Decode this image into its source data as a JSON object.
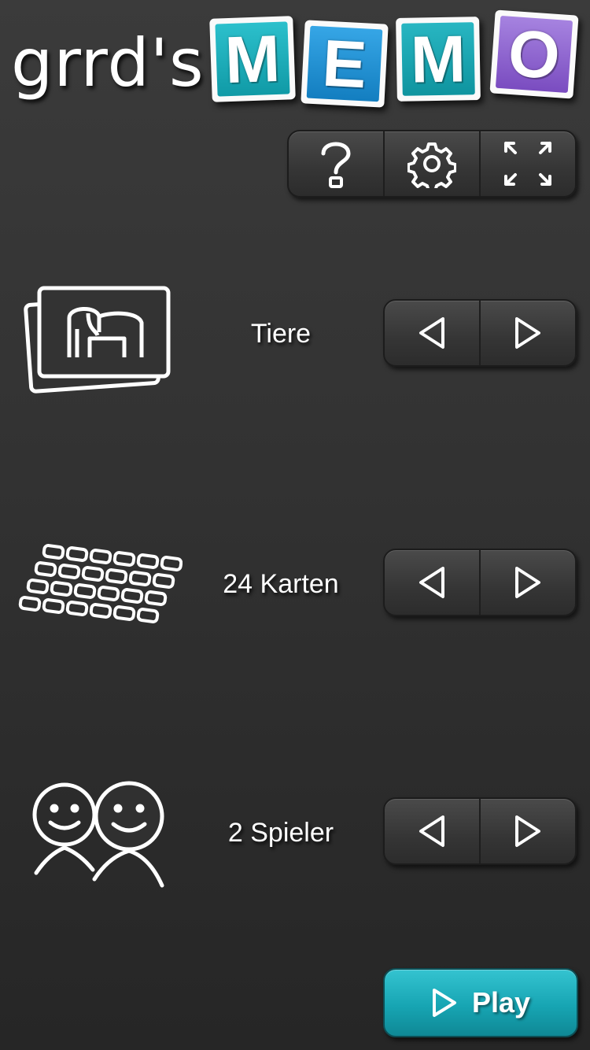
{
  "header": {
    "title_prefix": "grrd's",
    "logo_letters": [
      {
        "char": "M",
        "color": "#1aa8b6"
      },
      {
        "char": "E",
        "color": "#1d8fd1"
      },
      {
        "char": "M",
        "color": "#15a2ae"
      },
      {
        "char": "O",
        "color": "#8a5fcb"
      }
    ]
  },
  "toolbar": {
    "icons": [
      "help-icon",
      "settings-gear-icon",
      "fullscreen-icon"
    ]
  },
  "settings": {
    "theme": {
      "value": "Tiere",
      "icon": "animal-cards-icon"
    },
    "cards": {
      "value": "24 Karten",
      "icon": "card-grid-icon"
    },
    "players": {
      "value": "2 Spieler",
      "icon": "two-players-icon"
    }
  },
  "play_button": {
    "label": "Play",
    "color": "#1aa8b6"
  }
}
